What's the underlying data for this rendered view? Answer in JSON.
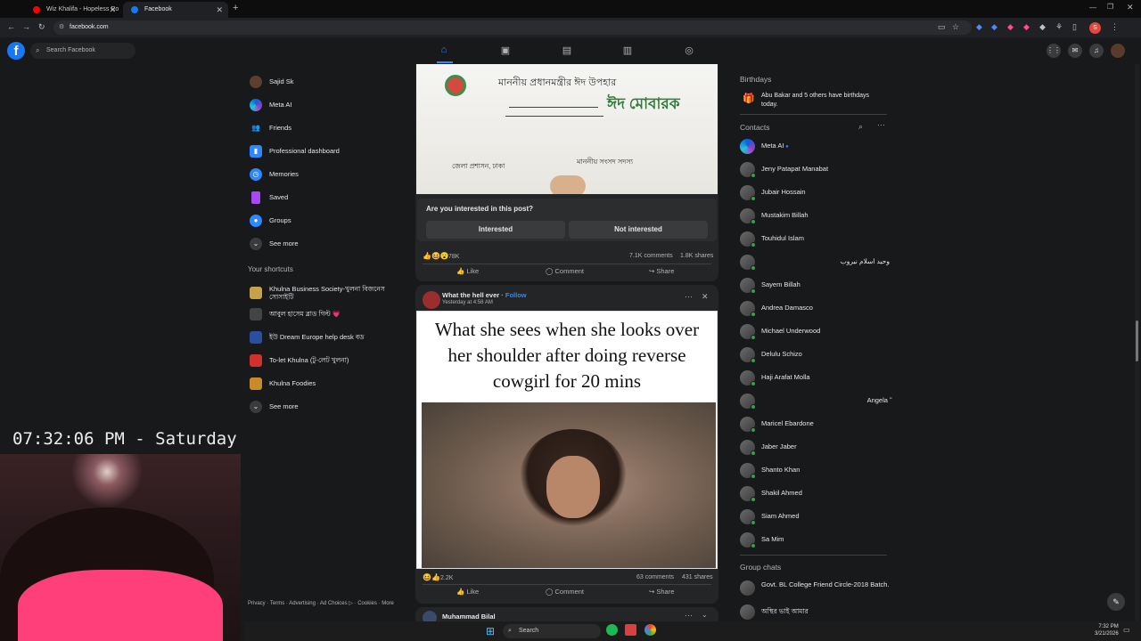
{
  "browser": {
    "tabs": [
      {
        "title": "Wiz Khalifa - Hopeless Ro",
        "favicon": "youtube-icon"
      },
      {
        "title": "Facebook",
        "favicon": "facebook-icon"
      }
    ],
    "url": "facebook.com"
  },
  "header": {
    "logo": "f",
    "search_placeholder": "Search Facebook",
    "nav": [
      "home-icon",
      "video-icon",
      "marketplace-icon",
      "gaming-icon",
      "groups-icon"
    ]
  },
  "left": {
    "items": [
      {
        "label": "Sajid Sk",
        "icon": "avatar"
      },
      {
        "label": "Meta AI",
        "icon": "meta-ai-icon"
      },
      {
        "label": "Friends",
        "icon": "friends-icon"
      },
      {
        "label": "Professional dashboard",
        "icon": "dashboard-icon"
      },
      {
        "label": "Memories",
        "icon": "memories-icon"
      },
      {
        "label": "Saved",
        "icon": "saved-icon"
      },
      {
        "label": "Groups",
        "icon": "groups-icon"
      },
      {
        "label": "See more",
        "icon": "chevron-down-icon"
      }
    ],
    "shortcuts_title": "Your shortcuts",
    "shortcuts": [
      {
        "label": "Khulna Business Society-খুলনা বিজনেস সোসাইটি"
      },
      {
        "label": "আবুল হাসেম ব্লাড গিল্ট 💗"
      },
      {
        "label": "ইউ Dream Europe help desk বড"
      },
      {
        "label": "To-let Khulna (টু-লেট খুলনা)"
      },
      {
        "label": "Khulna Foodies"
      },
      {
        "label": "See more"
      }
    ],
    "legal": "Privacy · Terms · Advertising · Ad Choices ▷ · Cookies · More"
  },
  "overlay": {
    "clock": "07:32:06 PM - Saturday"
  },
  "feed": {
    "post1": {
      "img_text_top": "মাননীয় প্রধানমন্ত্রীর ঈদ উপহার",
      "img_badge": "ঈদ মোবারক",
      "img_text_bottom": "মাননীয় সংসদ সদস্য",
      "img_office": "জেলা প্রশাসন, ঢাকা",
      "interest_question": "Are you interested in this post?",
      "interested_label": "Interested",
      "not_interested_label": "Not interested",
      "reactions": "78K",
      "comments": "7.1K comments",
      "shares": "1.8K shares",
      "like": "Like",
      "comment": "Comment",
      "share": "Share"
    },
    "post2": {
      "author": "What the hell ever",
      "follow": "Follow",
      "time": "Yesterday at 4:58 AM",
      "meme_text": "What she sees when she looks over her shoulder after doing reverse cowgirl for 20 mins",
      "reactions": "2.2K",
      "comments": "63 comments",
      "shares": "431 shares",
      "like": "Like",
      "comment": "Comment",
      "share": "Share"
    },
    "post3": {
      "author": "Muhammad Bilal"
    }
  },
  "right": {
    "birthdays_title": "Birthdays",
    "birthday_text": "Abu Bakar and 5 others have birthdays today.",
    "contacts_title": "Contacts",
    "contacts": [
      "Meta AI",
      "Jeny Patapat Manabat",
      "Jubair Hossain",
      "Mustakim Billah",
      "Touhidul Islam",
      "وحيد اسلام نيروب",
      "Sayem Billah",
      "Andrea Damasco",
      "Michael Underwood",
      "Delulu Schizo",
      "Haji Arafat Molla",
      "Angela ̃",
      "Maricel Ebardone",
      "Jaber Jaber",
      "Shanto Khan",
      "Shakil Ahmed",
      "Siam Ahmed",
      "Sa Mim"
    ],
    "group_chats_title": "Group chats",
    "group_chats": [
      "Govt. BL College Friend Circle-2018 Batch.",
      "অস্থির ভাই আমার"
    ]
  },
  "taskbar": {
    "search": "Search",
    "time": "7:32 PM",
    "date": "3/21/2026"
  },
  "colors": {
    "fb_blue": "#1877f2",
    "accent": "#2d88ff",
    "bg": "#18191a",
    "card": "#242526"
  }
}
